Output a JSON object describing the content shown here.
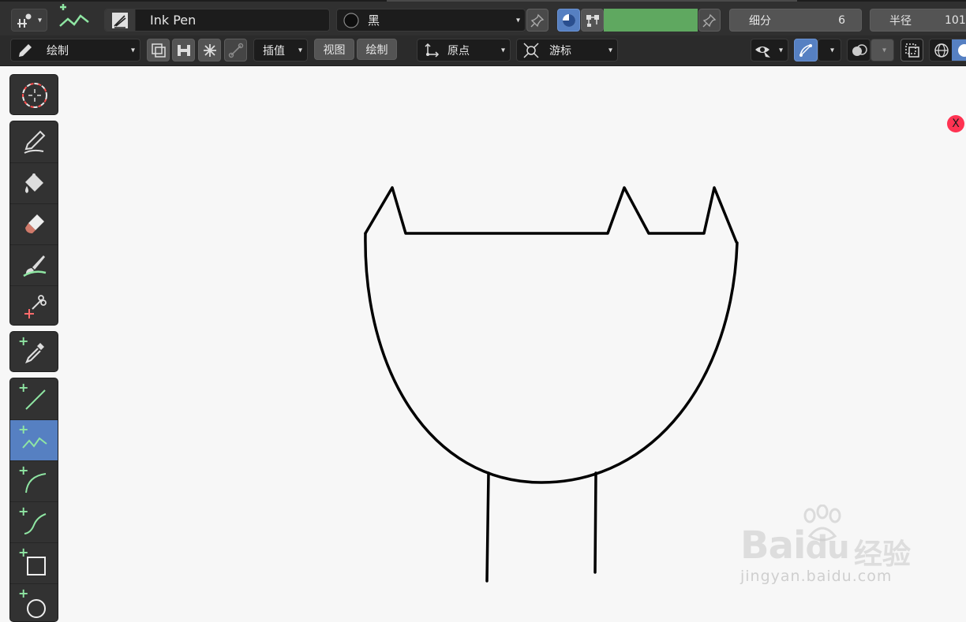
{
  "header": {
    "brush_name": "Ink Pen",
    "material_name": "黑",
    "color_hex": "#5fa860",
    "subdivision_label": "细分",
    "subdivision_value": "6",
    "radius_label": "半径",
    "radius_value": "101"
  },
  "toolsettings": {
    "mode_label": "绘制",
    "interpolate_label": "插值",
    "view_label": "视图",
    "draw_label": "绘制",
    "origin_label": "原点",
    "cursor_label": "游标"
  },
  "toolbar": {
    "active_tool": "polyline",
    "accent": "#5680c2"
  },
  "viewport": {
    "axis_label": "X",
    "axis_color": "#ff3352"
  },
  "watermark": {
    "brand": "Bai",
    "brand_tail": "du",
    "brand_cn": "经验",
    "url": "jingyan.baidu.com"
  }
}
